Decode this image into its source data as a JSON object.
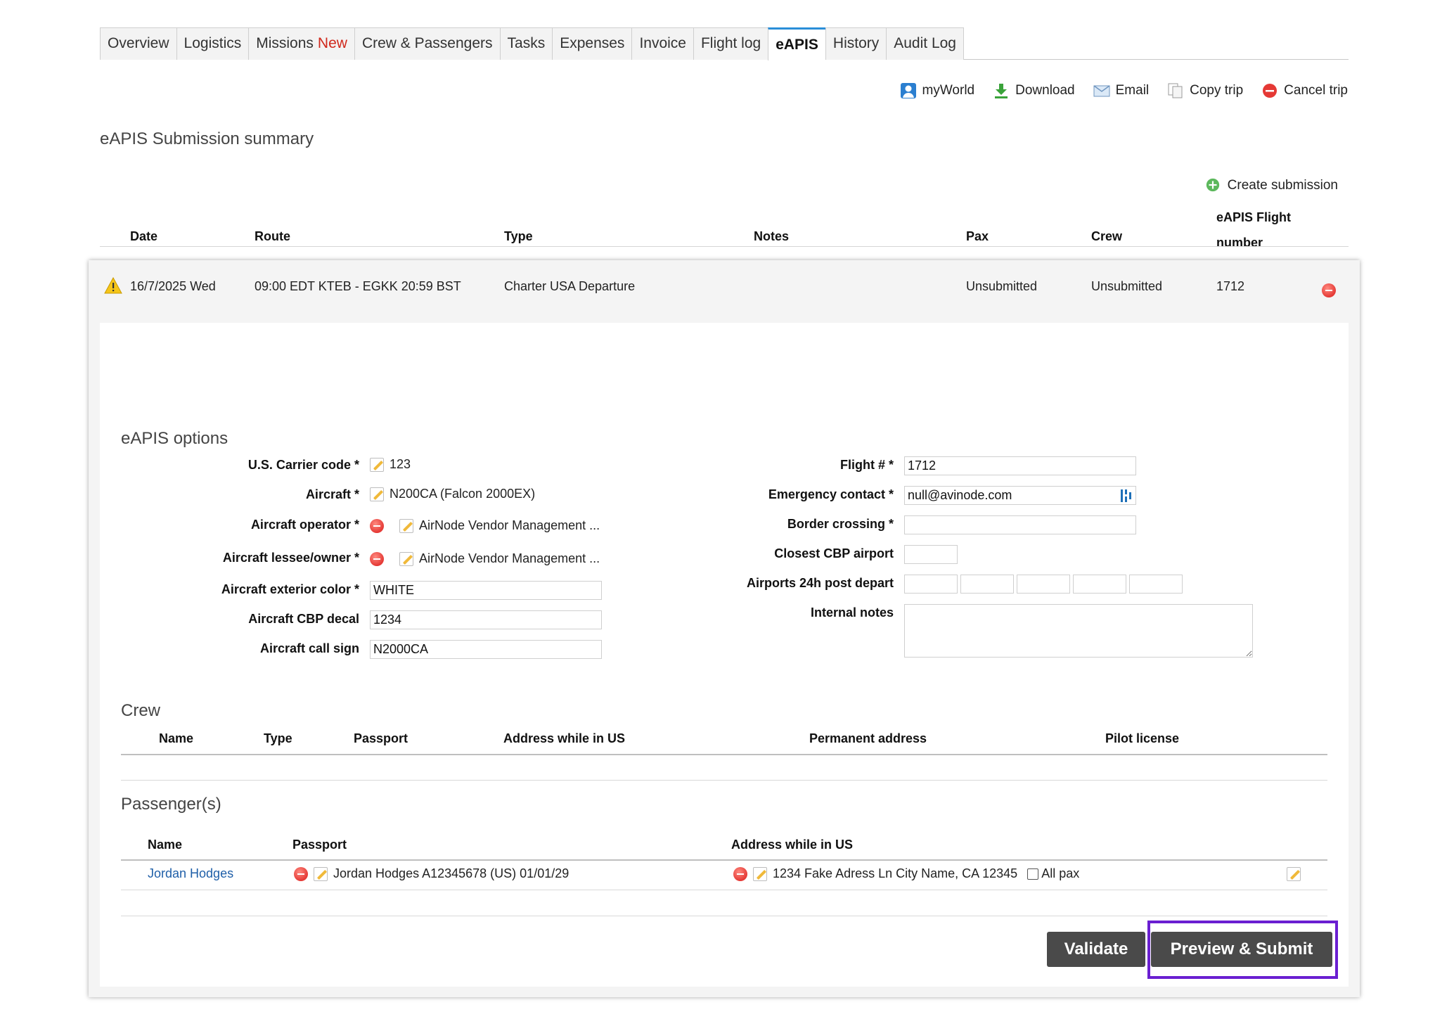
{
  "tabs": [
    {
      "label": "Overview"
    },
    {
      "label": "Logistics"
    },
    {
      "label": "Missions",
      "badge": "New"
    },
    {
      "label": "Crew & Passengers"
    },
    {
      "label": "Tasks"
    },
    {
      "label": "Expenses"
    },
    {
      "label": "Invoice"
    },
    {
      "label": "Flight log"
    },
    {
      "label": "eAPIS",
      "active": true
    },
    {
      "label": "History"
    },
    {
      "label": "Audit Log"
    }
  ],
  "actions": {
    "myworld": "myWorld",
    "download": "Download",
    "email": "Email",
    "copy_trip": "Copy trip",
    "cancel_trip": "Cancel trip"
  },
  "summary": {
    "title": "eAPIS Submission summary",
    "create_submission": "Create submission",
    "columns": {
      "date": "Date",
      "route": "Route",
      "type": "Type",
      "notes": "Notes",
      "pax": "Pax",
      "crew": "Crew",
      "flight_number_1": "eAPIS Flight",
      "flight_number_2": "number"
    },
    "row": {
      "date": "16/7/2025 Wed",
      "route": "09:00 EDT KTEB - EGKK 20:59 BST",
      "type": "Charter USA Departure",
      "notes": "",
      "pax": "Unsubmitted",
      "crew": "Unsubmitted",
      "flight_number": "1712"
    }
  },
  "options": {
    "title": "eAPIS options",
    "carrier_code_label": "U.S. Carrier code",
    "carrier_code_value": "123",
    "aircraft_label": "Aircraft",
    "aircraft_value": "N200CA (Falcon 2000EX)",
    "operator_label": "Aircraft operator",
    "operator_value": "AirNode Vendor Management ...",
    "lessee_label": "Aircraft lessee/owner",
    "lessee_value": "AirNode Vendor Management ...",
    "exterior_color_label": "Aircraft exterior color",
    "exterior_color_value": "WHITE",
    "cbp_decal_label": "Aircraft CBP decal",
    "cbp_decal_value": "1234",
    "call_sign_label": "Aircraft call sign",
    "call_sign_value": "N2000CA",
    "flight_no_label": "Flight #",
    "flight_no_value": "1712",
    "emergency_label": "Emergency contact",
    "emergency_value": "null@avinode.com",
    "border_label": "Border crossing",
    "border_value": "",
    "cbp_airport_label": "Closest CBP airport",
    "cbp_airport_value": "",
    "airports24_label": "Airports 24h post depart",
    "internal_notes_label": "Internal notes",
    "internal_notes_value": "",
    "required_mark": "*"
  },
  "crew": {
    "title": "Crew",
    "columns": {
      "name": "Name",
      "type": "Type",
      "passport": "Passport",
      "address_us": "Address while in US",
      "permanent": "Permanent address",
      "license": "Pilot license"
    }
  },
  "passengers": {
    "title": "Passenger(s)",
    "columns": {
      "name": "Name",
      "passport": "Passport",
      "address_us": "Address while in US"
    },
    "rows": [
      {
        "name": "Jordan Hodges",
        "passport": "Jordan Hodges A12345678 (US) 01/01/29",
        "address": "1234 Fake Adress Ln City Name, CA 12345",
        "all_pax": "All pax"
      }
    ]
  },
  "buttons": {
    "validate": "Validate",
    "preview_submit": "Preview & Submit"
  },
  "colors": {
    "highlight": "#6a1fd1",
    "active_tab": "#2a8ed8",
    "new_badge": "#d0281c",
    "button": "#4a4a4a",
    "link": "#1f5fa8"
  }
}
